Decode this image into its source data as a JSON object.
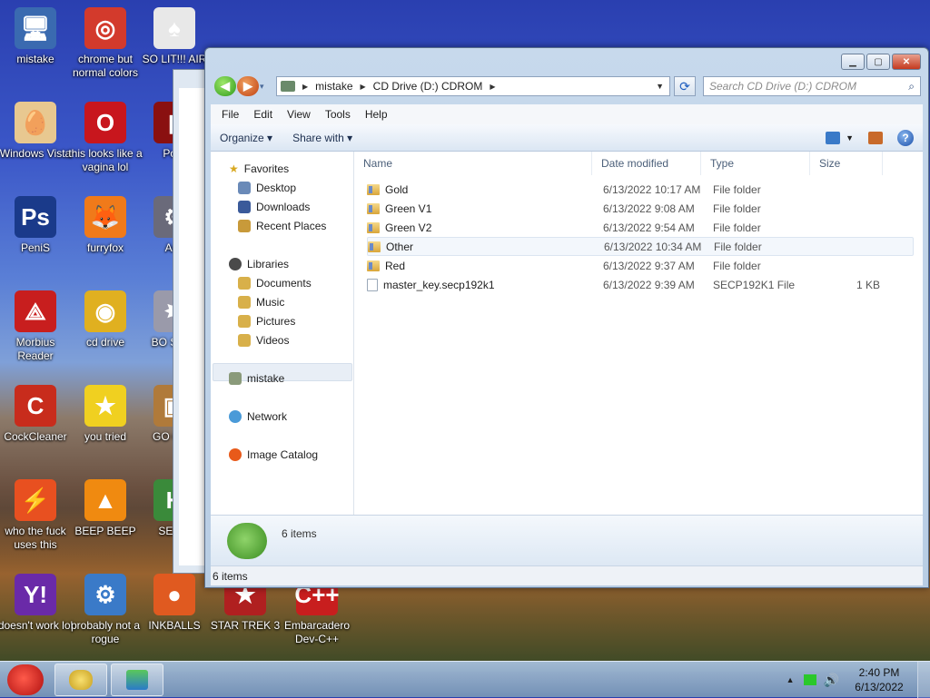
{
  "desktop_icons": [
    {
      "label": "mistake",
      "glyph": "🖥",
      "color": "#3a6ab0"
    },
    {
      "label": "chrome but normal colors",
      "glyph": "◎",
      "color": "#d33a2c"
    },
    {
      "label": "SO LIT!!! AIR",
      "glyph": "♠",
      "color": "#e8e8e8"
    },
    {
      "label": "Windows Vista",
      "glyph": "🥚",
      "color": "#e8c890"
    },
    {
      "label": "this looks like a vagina lol",
      "glyph": "O",
      "color": "#c8161d"
    },
    {
      "label": "Porn",
      "glyph": "▮",
      "color": "#8a1010"
    },
    {
      "label": "PeniS",
      "glyph": "Ps",
      "color": "#1a3a8a"
    },
    {
      "label": "furryfox",
      "glyph": "🦊",
      "color": "#f07a1a"
    },
    {
      "label": "Aus",
      "glyph": "⚙",
      "color": "#6a6a7a"
    },
    {
      "label": "Morbius Reader",
      "glyph": "⟁",
      "color": "#c81e1e"
    },
    {
      "label": "cd drive",
      "glyph": "◉",
      "color": "#e0b020"
    },
    {
      "label": "BO SIMU",
      "glyph": "✸",
      "color": "#9a9aaa"
    },
    {
      "label": "CockCleaner",
      "glyph": "C",
      "color": "#c82c1c"
    },
    {
      "label": "you tried",
      "glyph": "★",
      "color": "#f0d020"
    },
    {
      "label": "GO GAD",
      "glyph": "▣",
      "color": "#b07a3a"
    },
    {
      "label": "who the fuck uses this",
      "glyph": "⚡",
      "color": "#e85020"
    },
    {
      "label": "BEEP BEEP",
      "glyph": "▲",
      "color": "#f08a10"
    },
    {
      "label": "SEX E",
      "glyph": "H",
      "color": "#3a8a3a"
    },
    {
      "label": "doesn't work lol",
      "glyph": "Y!",
      "color": "#6a2aa8"
    },
    {
      "label": "probably not a rogue",
      "glyph": "⚙",
      "color": "#3a7ac8"
    },
    {
      "label": "INKBALLS",
      "glyph": "●",
      "color": "#e05a20"
    },
    {
      "label": "STAR TREK 3",
      "glyph": "★",
      "color": "#b02020"
    },
    {
      "label": "Embarcadero Dev-C++",
      "glyph": "C++",
      "color": "#c81e1e"
    }
  ],
  "window": {
    "address": [
      "mistake",
      "CD Drive (D:) CDROM"
    ],
    "search_placeholder": "Search CD Drive (D:) CDROM",
    "menu": [
      "File",
      "Edit",
      "View",
      "Tools",
      "Help"
    ],
    "toolbar": {
      "organize": "Organize ▾",
      "share": "Share with ▾"
    },
    "nav": {
      "favorites": "Favorites",
      "desktop": "Desktop",
      "downloads": "Downloads",
      "recent": "Recent Places",
      "libraries": "Libraries",
      "documents": "Documents",
      "music": "Music",
      "pictures": "Pictures",
      "videos": "Videos",
      "mistake": "mistake",
      "network": "Network",
      "image_catalog": "Image Catalog"
    },
    "columns": {
      "name": "Name",
      "date": "Date modified",
      "type": "Type",
      "size": "Size"
    },
    "rows": [
      {
        "name": "Gold",
        "date": "6/13/2022 10:17 AM",
        "type": "File folder",
        "size": "",
        "kind": "folder"
      },
      {
        "name": "Green V1",
        "date": "6/13/2022 9:08 AM",
        "type": "File folder",
        "size": "",
        "kind": "folder"
      },
      {
        "name": "Green V2",
        "date": "6/13/2022 9:54 AM",
        "type": "File folder",
        "size": "",
        "kind": "folder"
      },
      {
        "name": "Other",
        "date": "6/13/2022 10:34 AM",
        "type": "File folder",
        "size": "",
        "kind": "folder"
      },
      {
        "name": "Red",
        "date": "6/13/2022 9:37 AM",
        "type": "File folder",
        "size": "",
        "kind": "folder"
      },
      {
        "name": "master_key.secp192k1",
        "date": "6/13/2022 9:39 AM",
        "type": "SECP192K1 File",
        "size": "1 KB",
        "kind": "file"
      }
    ],
    "details_count": "6 items",
    "status_count": "6 items"
  },
  "tray": {
    "time": "2:40 PM",
    "date": "6/13/2022"
  }
}
